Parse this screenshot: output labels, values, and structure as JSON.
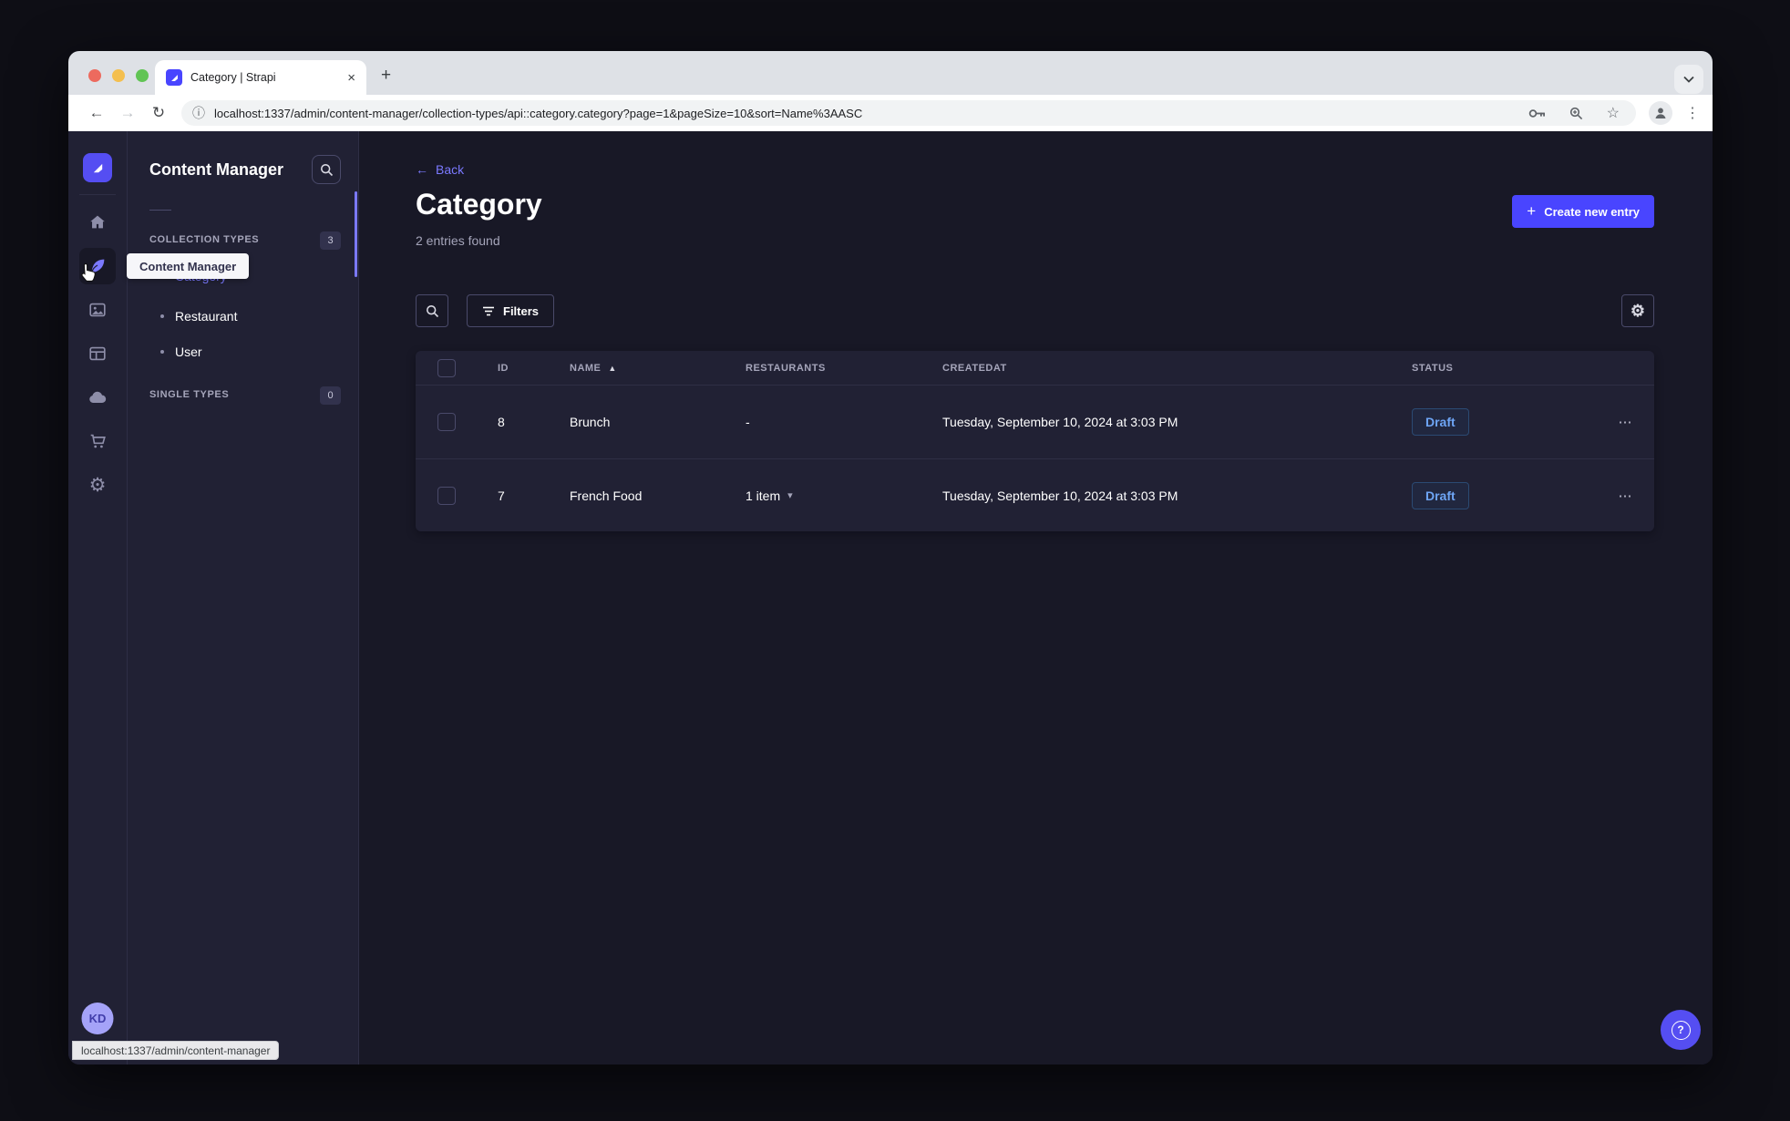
{
  "colors": {
    "accent": "#4945ff",
    "accent-light": "#7b79ff",
    "panel": "#212134",
    "bg": "#181826",
    "draft": "#6ea5f5"
  },
  "browser": {
    "tab_title": "Category | Strapi",
    "url": "localhost:1337/admin/content-manager/collection-types/api::category.category?page=1&pageSize=10&sort=Name%3AASC",
    "status_bar_url": "localhost:1337/admin/content-manager"
  },
  "icons": {
    "close": "×",
    "plus": "+",
    "back_arrow": "←",
    "forward_arrow": "→",
    "reload": "↻",
    "info": "ⓘ",
    "star": "☆",
    "dots_vertical": "⋮",
    "ellipsis": "⋯",
    "gear": "⚙",
    "sort_asc": "▲",
    "caret_down": "▾"
  },
  "sidebar": {
    "items": [
      {
        "name": "home"
      },
      {
        "name": "content-manager",
        "active": true
      },
      {
        "name": "media-library"
      },
      {
        "name": "content-type-builder"
      },
      {
        "name": "cloud"
      },
      {
        "name": "marketplace"
      },
      {
        "name": "settings"
      }
    ],
    "avatar_initials": "KD"
  },
  "subnav": {
    "title": "Content Manager",
    "collection_types_label": "COLLECTION TYPES",
    "collection_types_count": "3",
    "items": [
      {
        "label": "Category",
        "active": true
      },
      {
        "label": "Restaurant",
        "active": false
      },
      {
        "label": "User",
        "active": false
      }
    ],
    "single_types_label": "SINGLE TYPES",
    "single_types_count": "0"
  },
  "tooltip": {
    "label": "Content Manager"
  },
  "main": {
    "back_label": "Back",
    "title": "Category",
    "subtitle": "2 entries found",
    "create_button_label": "Create new entry",
    "filters_label": "Filters"
  },
  "table": {
    "headers": [
      "ID",
      "NAME",
      "RESTAURANTS",
      "CREATEDAT",
      "STATUS"
    ],
    "rows": [
      {
        "id": "8",
        "name": "Brunch",
        "restaurants": "-",
        "created_at": "Tuesday, September 10, 2024 at 3:03 PM",
        "status": "Draft"
      },
      {
        "id": "7",
        "name": "French Food",
        "restaurants": "1 item",
        "created_at": "Tuesday, September 10, 2024 at 3:03 PM",
        "status": "Draft"
      }
    ]
  }
}
